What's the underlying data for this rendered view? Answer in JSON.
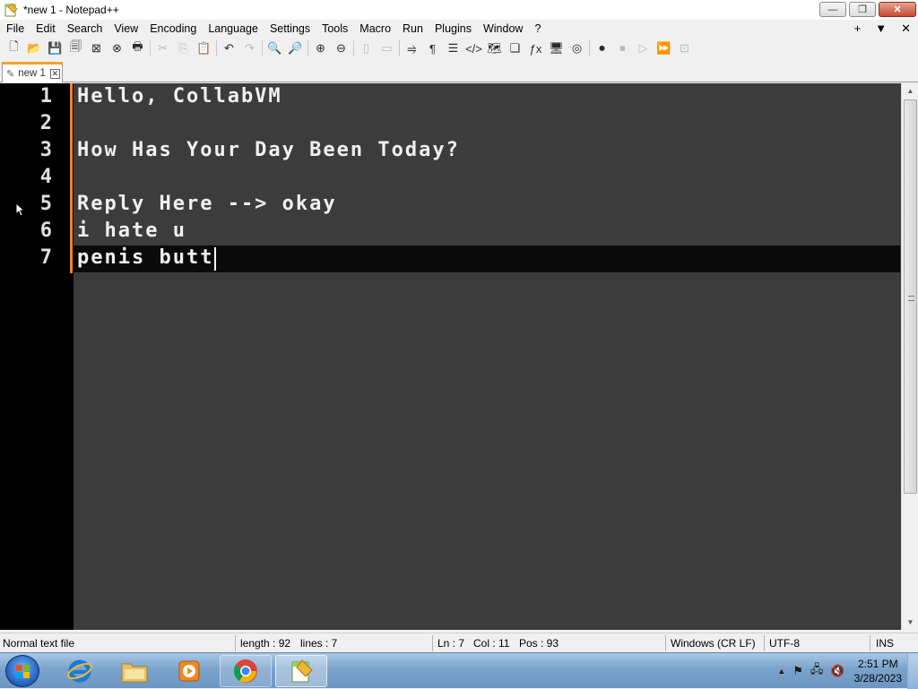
{
  "window": {
    "title": "*new 1 - Notepad++",
    "buttons": {
      "minimize": "—",
      "restore": "❐",
      "close": "✕"
    }
  },
  "menu": {
    "items": [
      "File",
      "Edit",
      "Search",
      "View",
      "Encoding",
      "Language",
      "Settings",
      "Tools",
      "Macro",
      "Run",
      "Plugins",
      "Window",
      "?"
    ],
    "right": [
      "+",
      "▼",
      "✕"
    ]
  },
  "toolbar": {
    "icons": [
      {
        "name": "new-file-icon",
        "glyph": "🗋",
        "enabled": true
      },
      {
        "name": "open-file-icon",
        "glyph": "📂",
        "enabled": true
      },
      {
        "name": "save-icon",
        "glyph": "💾",
        "enabled": true
      },
      {
        "name": "save-all-icon",
        "glyph": "🗐",
        "enabled": true
      },
      {
        "name": "close-file-icon",
        "glyph": "⊠",
        "enabled": true
      },
      {
        "name": "close-all-icon",
        "glyph": "⊗",
        "enabled": true
      },
      {
        "name": "print-icon",
        "glyph": "🖶",
        "enabled": true
      },
      {
        "name": "cut-icon",
        "glyph": "✂",
        "enabled": false
      },
      {
        "name": "copy-icon",
        "glyph": "⎘",
        "enabled": false
      },
      {
        "name": "paste-icon",
        "glyph": "📋",
        "enabled": false
      },
      {
        "name": "undo-icon",
        "glyph": "↶",
        "enabled": true
      },
      {
        "name": "redo-icon",
        "glyph": "↷",
        "enabled": false
      },
      {
        "name": "find-icon",
        "glyph": "🔍",
        "enabled": true
      },
      {
        "name": "replace-icon",
        "glyph": "🔎",
        "enabled": true
      },
      {
        "name": "zoom-in-icon",
        "glyph": "⊕",
        "enabled": true
      },
      {
        "name": "zoom-out-icon",
        "glyph": "⊖",
        "enabled": true
      },
      {
        "name": "sync-vertical-icon",
        "glyph": "▯",
        "enabled": false
      },
      {
        "name": "sync-horizontal-icon",
        "glyph": "▭",
        "enabled": false
      },
      {
        "name": "word-wrap-icon",
        "glyph": "⥤",
        "enabled": true
      },
      {
        "name": "show-all-chars-icon",
        "glyph": "¶",
        "enabled": true
      },
      {
        "name": "indent-guide-icon",
        "glyph": "☰",
        "enabled": true
      },
      {
        "name": "xml-tag-icon",
        "glyph": "</>",
        "enabled": true
      },
      {
        "name": "doc-map-icon",
        "glyph": "🗺",
        "enabled": true
      },
      {
        "name": "doc-list-icon",
        "glyph": "❏",
        "enabled": true
      },
      {
        "name": "function-list-icon",
        "glyph": "ƒx",
        "enabled": true
      },
      {
        "name": "folder-workspace-icon",
        "glyph": "🖥",
        "enabled": true
      },
      {
        "name": "monitoring-icon",
        "glyph": "◎",
        "enabled": true
      },
      {
        "name": "record-macro-icon",
        "glyph": "⏺",
        "enabled": true
      },
      {
        "name": "stop-macro-icon",
        "glyph": "⏹",
        "enabled": false
      },
      {
        "name": "play-macro-icon",
        "glyph": "▷",
        "enabled": false
      },
      {
        "name": "run-macro-multiple-icon",
        "glyph": "⏩",
        "enabled": true
      },
      {
        "name": "save-macro-icon",
        "glyph": "⊡",
        "enabled": false
      }
    ]
  },
  "tabs": [
    {
      "label": "new 1",
      "close": "✕"
    }
  ],
  "editor": {
    "lines": [
      {
        "num": "1",
        "text": "Hello, CollabVM"
      },
      {
        "num": "2",
        "text": ""
      },
      {
        "num": "3",
        "text": "How Has Your Day Been Today?"
      },
      {
        "num": "4",
        "text": ""
      },
      {
        "num": "5",
        "text": "Reply Here --> okay"
      },
      {
        "num": "6",
        "text": "i hate u"
      },
      {
        "num": "7",
        "text": "penis butt"
      }
    ],
    "current_line": 7
  },
  "status": {
    "type": "Normal text file",
    "length": "length : 92",
    "lines": "lines : 7",
    "ln": "Ln : 7",
    "col": "Col : 11",
    "pos": "Pos : 93",
    "eol": "Windows (CR LF)",
    "encoding": "UTF-8",
    "mode": "INS"
  },
  "taskbar": {
    "apps": [
      "internet-explorer",
      "windows-explorer",
      "media-player",
      "chrome",
      "notepad-plus-plus"
    ],
    "clock_time": "2:51 PM",
    "clock_date": "3/28/2023"
  },
  "colors": {
    "accent": "#f6a229",
    "editor_bg": "#3c3c3c",
    "gutter_bg": "#000000",
    "fold_margin": "#f08030"
  }
}
